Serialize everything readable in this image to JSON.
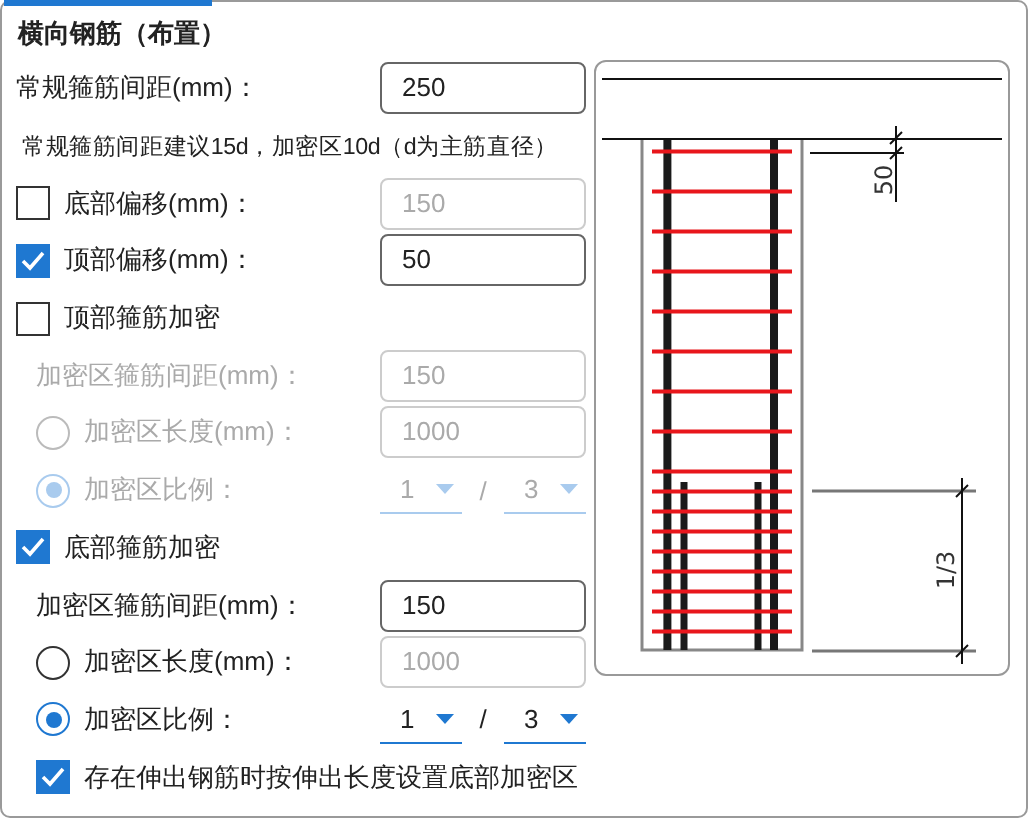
{
  "title": "横向钢筋（布置）",
  "rows": [
    {
      "kind": "field",
      "label": "常规箍筋间距(mm)：",
      "value": "250"
    },
    {
      "kind": "note",
      "text": "常规箍筋间距建议15d，加密区10d（d为主筋直径）"
    },
    {
      "kind": "check_field",
      "label": "底部偏移(mm)：",
      "checked": false,
      "value": "150"
    },
    {
      "kind": "check_field",
      "label": "顶部偏移(mm)：",
      "checked": true,
      "value": "50"
    },
    {
      "kind": "group",
      "label": "顶部箍筋加密",
      "checked": false,
      "children": [
        {
          "kind": "field",
          "label": "加密区箍筋间距(mm)：",
          "value": "150"
        },
        {
          "kind": "radio_field",
          "label": "加密区长度(mm)：",
          "selected": false,
          "value": "1000"
        },
        {
          "kind": "radio_ratio",
          "label": "加密区比例：",
          "selected": true,
          "numerator": "1",
          "separator": "/",
          "denominator": "3"
        }
      ]
    },
    {
      "kind": "group",
      "label": "底部箍筋加密",
      "checked": true,
      "children": [
        {
          "kind": "field",
          "label": "加密区箍筋间距(mm)：",
          "value": "150"
        },
        {
          "kind": "radio_field",
          "label": "加密区长度(mm)：",
          "selected": false,
          "value": "1000"
        },
        {
          "kind": "radio_ratio",
          "label": "加密区比例：",
          "selected": true,
          "numerator": "1",
          "separator": "/",
          "denominator": "3"
        },
        {
          "kind": "checkbox",
          "label": "存在伸出钢筋时按伸出长度设置底部加密区",
          "checked": true
        }
      ]
    }
  ],
  "diagram": {
    "offset_label": "50",
    "ratio_label": "1/3"
  }
}
